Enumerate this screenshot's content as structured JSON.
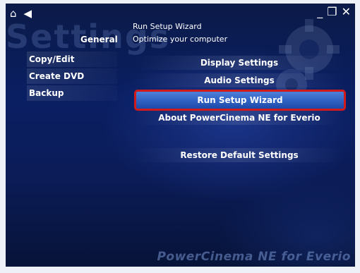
{
  "window": {
    "section_title": "General",
    "header_title": "Run Setup Wizard",
    "header_subtitle": "Optimize your computer",
    "watermark": "Settings",
    "logo": "PowerCinema NE for Everio"
  },
  "icons": {
    "home": "home-icon",
    "back": "back-arrow-icon",
    "minimize": "minimize-icon",
    "restore": "restore-window-icon",
    "close": "close-icon",
    "decor": "gear-icon"
  },
  "sidebar": {
    "items": [
      {
        "label": "Copy/Edit"
      },
      {
        "label": "Create DVD"
      },
      {
        "label": "Backup"
      }
    ]
  },
  "menu": {
    "items": [
      {
        "label": "Display Settings"
      },
      {
        "label": "Audio Settings"
      },
      {
        "label": "Run Setup Wizard",
        "selected": true
      },
      {
        "label": "About PowerCinema NE for Everio"
      },
      {
        "label": "Restore Default Settings"
      }
    ]
  },
  "colors": {
    "background": "#0a1f63",
    "highlight_border": "#d31a1a",
    "selected_fill": "#3366c8"
  }
}
